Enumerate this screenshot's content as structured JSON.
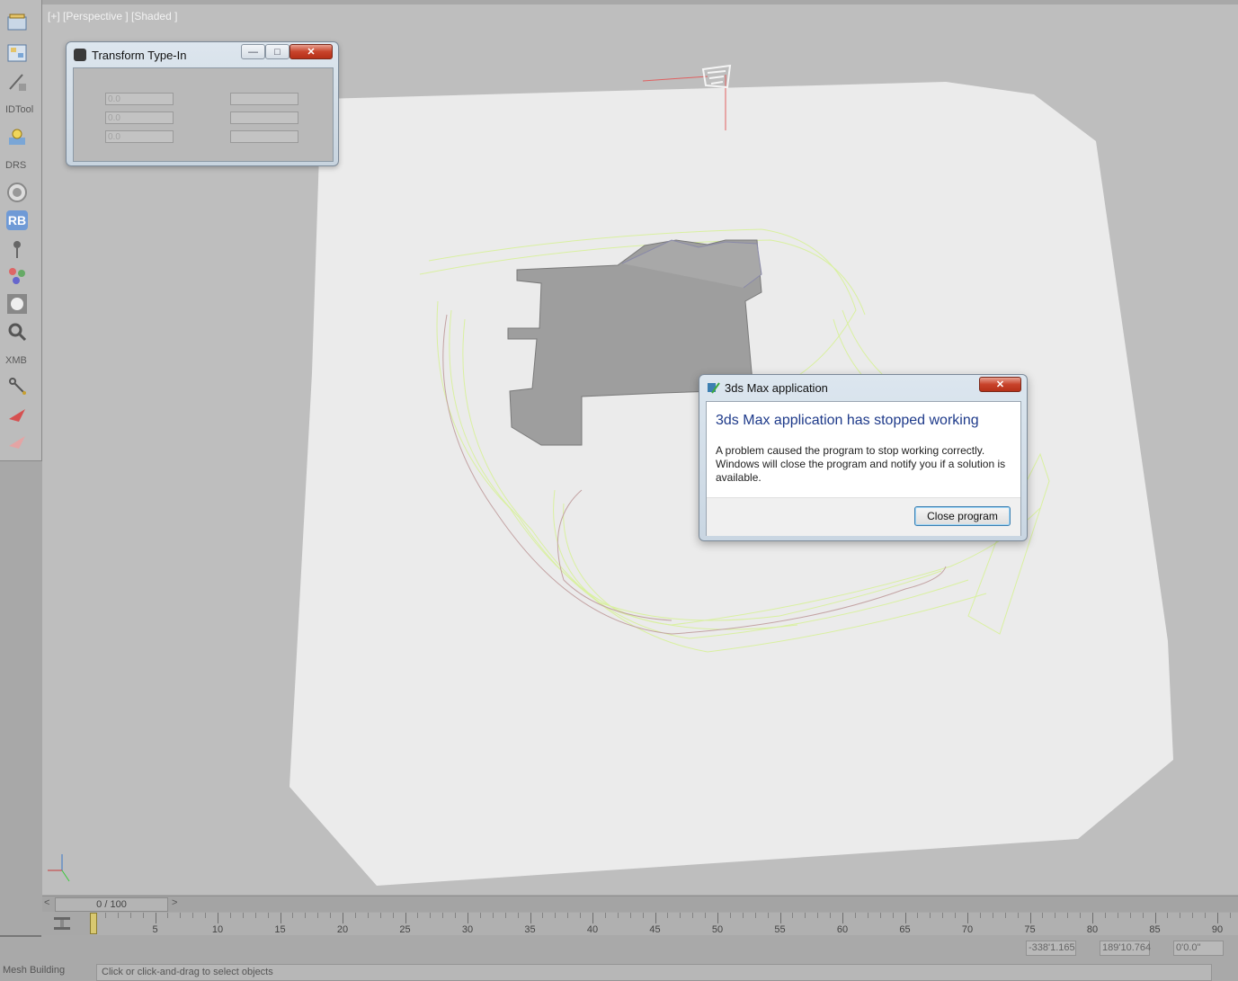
{
  "viewport": {
    "label": "[+] [Perspective ] [Shaded ]"
  },
  "left_toolbar": {
    "labels": [
      "IDTool",
      "DRS",
      "XMB"
    ],
    "rb_label": "RB",
    "icons": [
      "scene-explorer-icon",
      "layer-explorer-icon",
      "brush-icon",
      "light-icon",
      "ring-icon",
      "rb-icon",
      "pin-icon",
      "particles-icon",
      "face-icon",
      "magnifier-icon",
      "link-icon",
      "plane-icon",
      "plane-faded-icon"
    ]
  },
  "transform_type_in": {
    "title": "Transform Type-In",
    "fields": [
      "0.0",
      "0.0",
      "0.0"
    ]
  },
  "error_dialog": {
    "title": "3ds Max application",
    "heading": "3ds Max application has stopped working",
    "message": "A problem caused the program to stop working correctly. Windows will close the program and notify you if a solution is available.",
    "close_button": "Close program"
  },
  "timeline": {
    "frame_display": "0 / 100",
    "prev_label": "<",
    "next_label": ">",
    "ticks": [
      "5",
      "10",
      "15",
      "20",
      "25",
      "30",
      "35",
      "40",
      "45",
      "50",
      "55",
      "60",
      "65",
      "70",
      "75",
      "80",
      "85",
      "90"
    ]
  },
  "status": {
    "coords": [
      "-338'1.165",
      "189'10.764",
      "0'0.0\""
    ],
    "selection": "Mesh Building",
    "prompt": "Click or click-and-drag to select objects"
  },
  "colors": {
    "viewport_bg": "#bebebe",
    "terrain": "#ececec",
    "building": "#9e9e9e",
    "contour": "#d9f0a0",
    "dialog_heading": "#1e3a8a"
  }
}
